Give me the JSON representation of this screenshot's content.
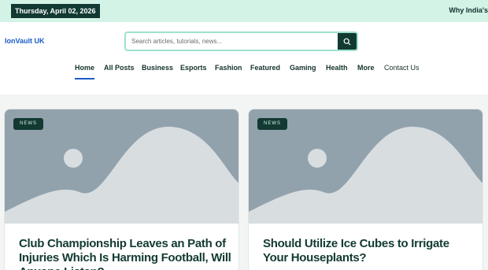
{
  "topbar": {
    "date": "Thursday, April 02, 2026",
    "ticker": "Why India's"
  },
  "header": {
    "logo": "IonVault UK",
    "search_placeholder": "Search articles, tutorials, news...",
    "search_icon": "search-icon"
  },
  "nav": {
    "items": [
      {
        "label": "Home"
      },
      {
        "label": "All Posts"
      },
      {
        "label": "Business"
      },
      {
        "label": "Esports"
      },
      {
        "label": "Fashion"
      },
      {
        "label": "Featured"
      },
      {
        "label": "Gaming"
      },
      {
        "label": "Health"
      },
      {
        "label": "More"
      },
      {
        "label": "Contact Us"
      }
    ]
  },
  "cards": [
    {
      "category": "NEWS",
      "title": "Club Championship Leaves an Path of Injuries Which Is Harming Football, Will Anyone Listen?"
    },
    {
      "category": "NEWS",
      "title": "Should Utilize Ice Cubes to Irrigate Your Houseplants?"
    }
  ],
  "colors": {
    "accent_dark": "#123a32",
    "topbar_bg": "#d3f3e7",
    "link_blue": "#1b5cc6",
    "placeholder_gray": "#92a2ad"
  }
}
